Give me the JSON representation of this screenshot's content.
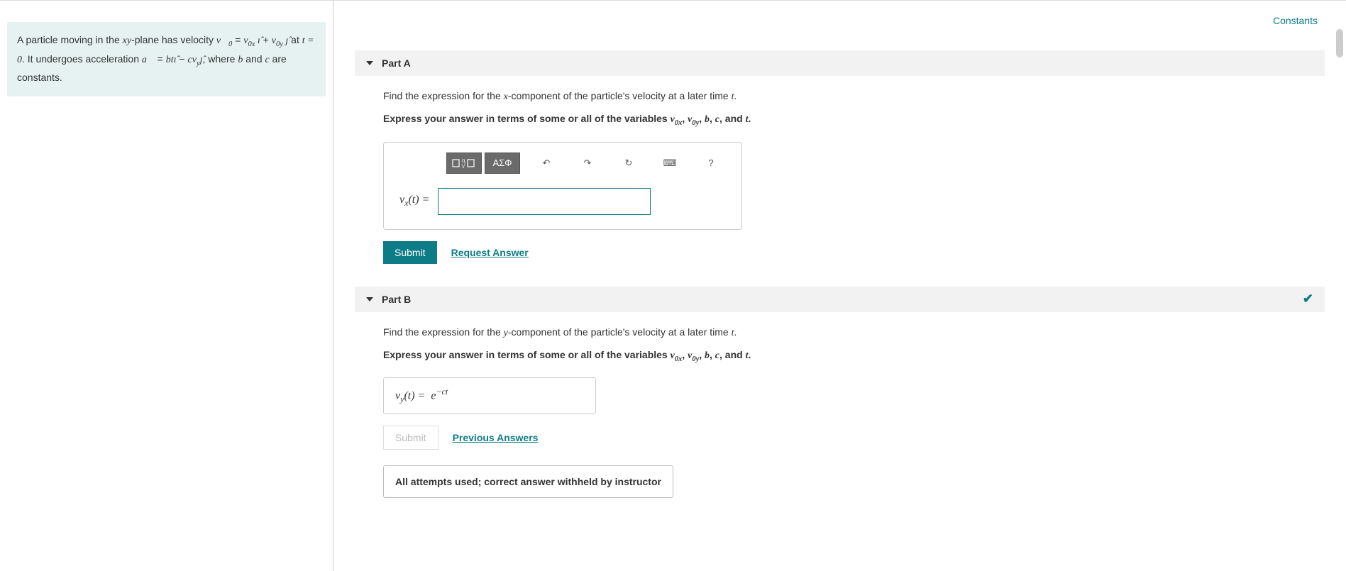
{
  "constants_link": "Constants",
  "problem": {
    "text_prefix": "A particle moving in the ",
    "xy": "xy",
    "text_mid1": "-plane has velocity ",
    "v0_sym": "v⃗",
    "v0_sub": "0",
    "eq1": " = ",
    "v0x": "v",
    "v0x_sub": "0x",
    "ihat": " ı̂",
    "plus": " + ",
    "v0y": "v",
    "v0y_sub": "0y",
    "jhat": " ȷ̂",
    "at_t0": " at ",
    "t_eq_0": "t = 0",
    "text_mid2": ". It undergoes acceleration ",
    "a_sym": "a⃗",
    "eq2": " = ",
    "bt": "bt",
    "ihat2": "ı̂",
    "minus": " − ",
    "c": "c",
    "vy": "v",
    "vy_sub": "y",
    "jhat2": "ȷ̂",
    "text_end": ", where ",
    "b": "b",
    "and": " and ",
    "c2": "c",
    "are_constants": " are constants."
  },
  "partA": {
    "title": "Part A",
    "prompt_prefix": "Find the expression for the ",
    "x": "x",
    "prompt_mid": "-component of the particle's velocity at a later time ",
    "t": "t",
    "prompt_suffix": ".",
    "instruction_prefix": "Express your answer in terms of some or all of the variables ",
    "var1": "v",
    "var1_sub": "0x",
    "sep1": ", ",
    "var2": "v",
    "var2_sub": "0y",
    "sep2": ", ",
    "var3": "b",
    "sep3": ", ",
    "var4": "c",
    "sep4": ", and ",
    "var5": "t",
    "instruction_suffix": ".",
    "toolbar": {
      "templates_alt": "templates",
      "greek": "ΑΣΦ",
      "undo": "↶",
      "redo": "↷",
      "reset": "↻",
      "keyboard": "⌨",
      "help": "?"
    },
    "answer_label_prefix": "v",
    "answer_label_sub": "x",
    "answer_label_arg": "(t)",
    "answer_label_eq": " = ",
    "submit": "Submit",
    "request_link": "Request Answer"
  },
  "partB": {
    "title": "Part B",
    "prompt_prefix": "Find the expression for the ",
    "y": "y",
    "prompt_mid": "-component of the particle's velocity at a later time ",
    "t": "t",
    "prompt_suffix": ".",
    "instruction_prefix": "Express your answer in terms of some or all of the variables ",
    "var1": "v",
    "var1_sub": "0x",
    "sep1": ", ",
    "var2": "v",
    "var2_sub": "0y",
    "sep2": ", ",
    "var3": "b",
    "sep3": ", ",
    "var4": "c",
    "sep4": ", and ",
    "var5": "t",
    "instruction_suffix": ".",
    "answer_label_prefix": "v",
    "answer_label_sub": "y",
    "answer_label_arg": "(t)",
    "answer_label_eq": " = ",
    "answer_value_base": "e",
    "answer_value_exp": "−ct",
    "submit": "Submit",
    "prev_link": "Previous Answers",
    "feedback": "All attempts used; correct answer withheld by instructor"
  }
}
